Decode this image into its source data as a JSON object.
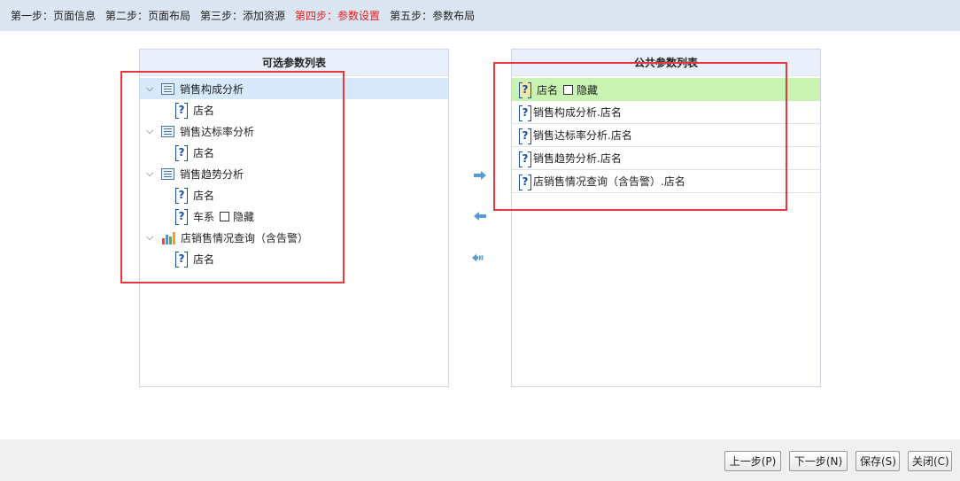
{
  "steps": [
    {
      "label": "第一步：页面信息",
      "active": false
    },
    {
      "label": "第二步：页面布局",
      "active": false
    },
    {
      "label": "第三步：添加资源",
      "active": false
    },
    {
      "label": "第四步：参数设置",
      "active": true
    },
    {
      "label": "第五步：参数布局",
      "active": false
    }
  ],
  "left_panel": {
    "title": "可选参数列表",
    "nodes": [
      {
        "label": "销售构成分析",
        "type": "report"
      },
      {
        "label": "店名",
        "type": "param"
      },
      {
        "label": "销售达标率分析",
        "type": "report"
      },
      {
        "label": "店名",
        "type": "param"
      },
      {
        "label": "销售趋势分析",
        "type": "report"
      },
      {
        "label": "店名",
        "type": "param"
      },
      {
        "label": "车系",
        "hide_label": "隐藏",
        "type": "param"
      },
      {
        "label": "店销售情况查询（含告警）",
        "type": "chart"
      },
      {
        "label": "店名",
        "type": "param"
      }
    ]
  },
  "right_panel": {
    "title": "公共参数列表",
    "rows": [
      {
        "label": "店名",
        "hide_label": "隐藏"
      },
      {
        "label": "销售构成分析.店名"
      },
      {
        "label": "销售达标率分析.店名"
      },
      {
        "label": "销售趋势分析.店名"
      },
      {
        "label": "店销售情况查询（含告警）.店名"
      }
    ]
  },
  "buttons": {
    "prev": "上一步(P)",
    "next": "下一步(N)",
    "save": "保存(S)",
    "close": "关闭(C)"
  },
  "colors": {
    "accent_red": "#e02020",
    "highlight_box": "#e8383d",
    "row_green": "#c8f3b2",
    "header_bg": "#dce6f2",
    "arrow_blue": "#5b9bd5"
  },
  "icons": [
    "chevron-down-icon",
    "report-icon",
    "chart-icon",
    "param-icon",
    "move-right-icon",
    "move-left-icon",
    "move-all-left-icon"
  ]
}
